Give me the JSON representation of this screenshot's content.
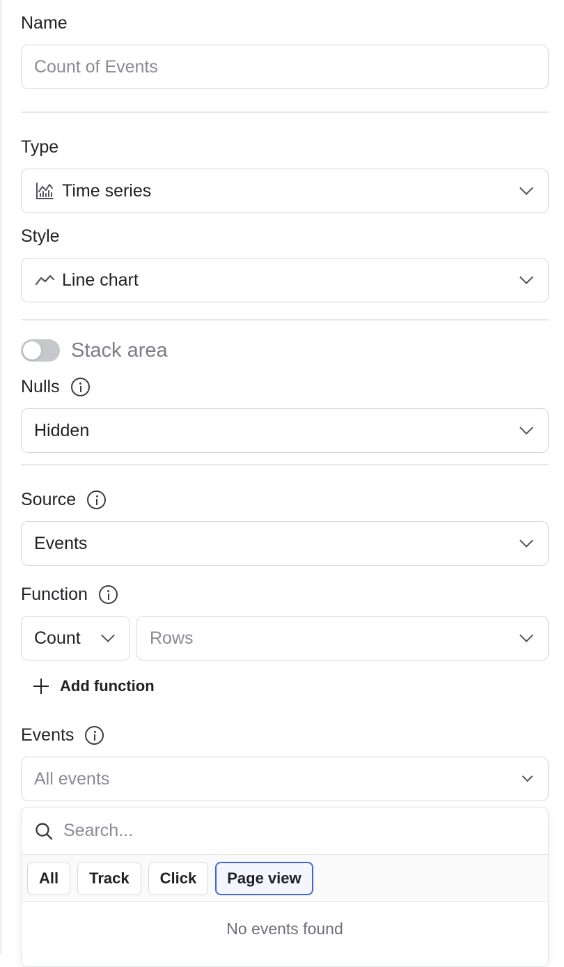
{
  "name": {
    "label": "Name",
    "placeholder": "Count of Events"
  },
  "type": {
    "label": "Type",
    "value": "Time series",
    "icon": "bar-chart-icon"
  },
  "style": {
    "label": "Style",
    "value": "Line chart",
    "icon": "line-chart-icon"
  },
  "stack_area": {
    "label": "Stack area",
    "enabled": false
  },
  "nulls": {
    "label": "Nulls",
    "value": "Hidden"
  },
  "source": {
    "label": "Source",
    "value": "Events"
  },
  "function": {
    "label": "Function",
    "aggregate": "Count",
    "column_placeholder": "Rows",
    "add_label": "Add function"
  },
  "events": {
    "label": "Events",
    "value": "All events",
    "search_placeholder": "Search...",
    "filters": [
      "All",
      "Track",
      "Click",
      "Page view"
    ],
    "active_filter": "Page view",
    "empty_text": "No events found"
  },
  "colors": {
    "accent": "#3d63dd",
    "border": "#d6d7db",
    "muted": "#8a8b92"
  }
}
